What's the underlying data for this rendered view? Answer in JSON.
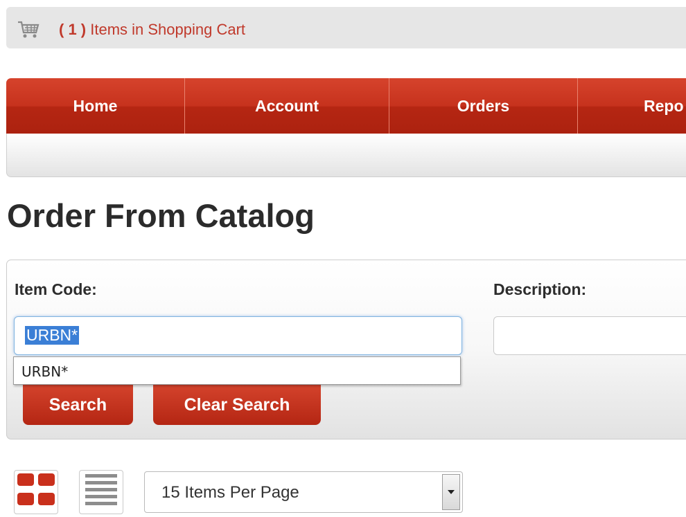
{
  "cart": {
    "count": "( 1 )",
    "label": " Items in Shopping Cart",
    "icon": "shopping-cart-icon"
  },
  "nav": {
    "items": [
      {
        "label": "Home"
      },
      {
        "label": "Account"
      },
      {
        "label": "Orders"
      },
      {
        "label": "Repo"
      }
    ]
  },
  "page": {
    "title": "Order From Catalog"
  },
  "search": {
    "item_code_label": "Item Code:",
    "item_code_value": "URBN*",
    "description_label": "Description:",
    "description_value": "",
    "autocomplete_option": "URBN*",
    "search_button": "Search",
    "clear_button": "Clear Search"
  },
  "view": {
    "grid_icon": "grid-view-icon",
    "list_icon": "list-view-icon",
    "per_page": "15 Items Per Page"
  },
  "colors": {
    "accent": "#c0392b",
    "nav_red": "#c6321d",
    "grid_icon_red": "#c9301c"
  }
}
